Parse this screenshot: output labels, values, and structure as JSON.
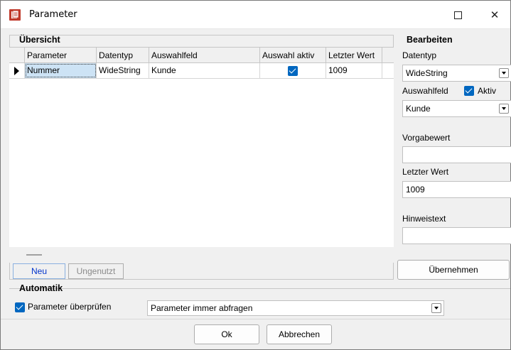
{
  "window": {
    "title": "Parameter",
    "icons": {
      "app": "document-stack-icon",
      "maximize": "maximize-icon",
      "close": "close-icon"
    },
    "close_glyph": "✕"
  },
  "overview": {
    "title": "Übersicht",
    "columns": [
      "Parameter",
      "Datentyp",
      "Auswahlfeld",
      "Auswahl aktiv",
      "Letzter Wert"
    ],
    "rows": [
      {
        "parameter": "Nummer",
        "datatype": "WideString",
        "selection_field": "Kunde",
        "selection_active": true,
        "last_value": "1009"
      }
    ],
    "buttons": {
      "new": "Neu",
      "unused": "Ungenutzt"
    }
  },
  "edit": {
    "title": "Bearbeiten",
    "datatype_label": "Datentyp",
    "datatype_value": "WideString",
    "selection_field_label": "Auswahlfeld",
    "active_label": "Aktiv",
    "active_checked": true,
    "selection_field_value": "Kunde",
    "default_value_label": "Vorgabewert",
    "default_value": "",
    "last_value_label": "Letzter Wert",
    "last_value": "1009",
    "hint_label": "Hinweistext",
    "hint_value": "",
    "apply_button": "Übernehmen"
  },
  "automatic": {
    "title": "Automatik",
    "check_label": "Parameter überprüfen",
    "checked": true,
    "mode_value": "Parameter immer abfragen"
  },
  "footer": {
    "ok": "Ok",
    "cancel": "Abbrechen"
  },
  "colors": {
    "accent": "#0067c0",
    "selection": "#cde3f5"
  }
}
